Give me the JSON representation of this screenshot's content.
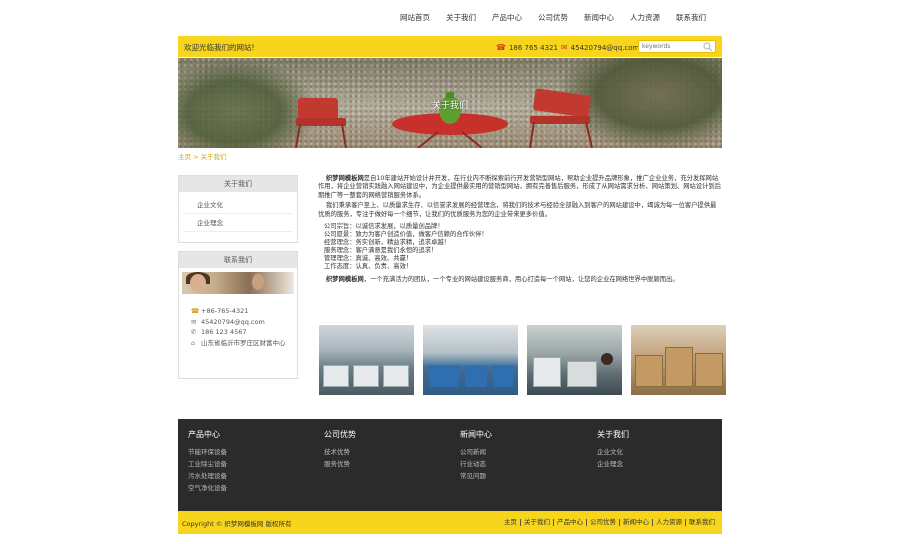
{
  "nav": [
    "网站首页",
    "关于我们",
    "产品中心",
    "公司优势",
    "新闻中心",
    "人力资源",
    "联系我们"
  ],
  "header": {
    "welcome": "欢迎光临我们的网站!",
    "phone": "186 765 4321",
    "email": "45420794@qq.com",
    "search_placeholder": "keywords"
  },
  "banner": {
    "title": "关于我们"
  },
  "breadcrumb": {
    "home": "主页",
    "sep": " > ",
    "current": "关于我们"
  },
  "sidebar": {
    "about_title": "关于我们",
    "about_items": [
      "企业文化",
      "企业理念"
    ],
    "contact_title": "联系我们",
    "contact_lines": [
      {
        "icon": "phone-icon",
        "text": "+86-765-4321"
      },
      {
        "icon": "mail-icon",
        "text": "45420794@qq.com"
      },
      {
        "icon": "mobile-icon",
        "text": "186 123 4567"
      },
      {
        "icon": "location-icon",
        "text": "山东省临沂市罗庄区财富中心"
      }
    ]
  },
  "main": {
    "para1_bold": "织梦网模板网",
    "para1": "是自10年建站开始设计并开发，在行业内不断探索前行开发营销型网站，帮助企业提升品牌形象，推广企业业务，充分发挥网站作用，将企业营销实践融入网站建设中，为企业提供最实用的营销型网站，拥有完善售后服务，形成了从网站需求分析、网站策划、网站设计到后期推广等一整套的网络营销服务体系。",
    "para2": "我们秉承客户至上、以质量求生存、以信誉求发展的经营理念，将我们的技术与经验全部融入到客户的网站建设中，竭诚为每一位客户提供最优质的服务，专注于做好每一个细节，让我们的优质服务为您的企业带来更多价值。",
    "list": [
      "公司宗旨：以诚信求发展，以质量创品牌！",
      "公司愿景：致力为客户创造价值，做客户信赖的合作伙伴！",
      "经营理念：务实创新，精益求精，追求卓越！",
      "服务理念：客户满意是我们永恒的追求！",
      "管理理念：真诚、高效、共赢！",
      "工作态度：认真、负责、高效！"
    ],
    "para3_bold": "织梦网模板网",
    "para3": "，一个充满活力的团队，一个专业的网站建设服务商，用心打造每一个网站，让您的企业在网络世界中脱颖而出。"
  },
  "footer": {
    "columns": [
      {
        "title": "产品中心",
        "items": [
          "节能环保设备",
          "工业除尘设备",
          "污水处理设备",
          "空气净化设备"
        ]
      },
      {
        "title": "公司优势",
        "items": [
          "技术优势",
          "服务优势"
        ]
      },
      {
        "title": "新闻中心",
        "items": [
          "公司新闻",
          "行业动态",
          "常见问题"
        ]
      },
      {
        "title": "关于我们",
        "items": [
          "企业文化",
          "企业理念"
        ]
      }
    ],
    "copyright": "Copyright © 织梦网模板网 版权所有",
    "links": [
      "主页",
      "关于我们",
      "产品中心",
      "公司优势",
      "新闻中心",
      "人力资源",
      "联系我们"
    ]
  },
  "colors": {
    "accent": "#f7d51d",
    "footer_bg": "#2b2b2b",
    "link": "#e0a800"
  }
}
